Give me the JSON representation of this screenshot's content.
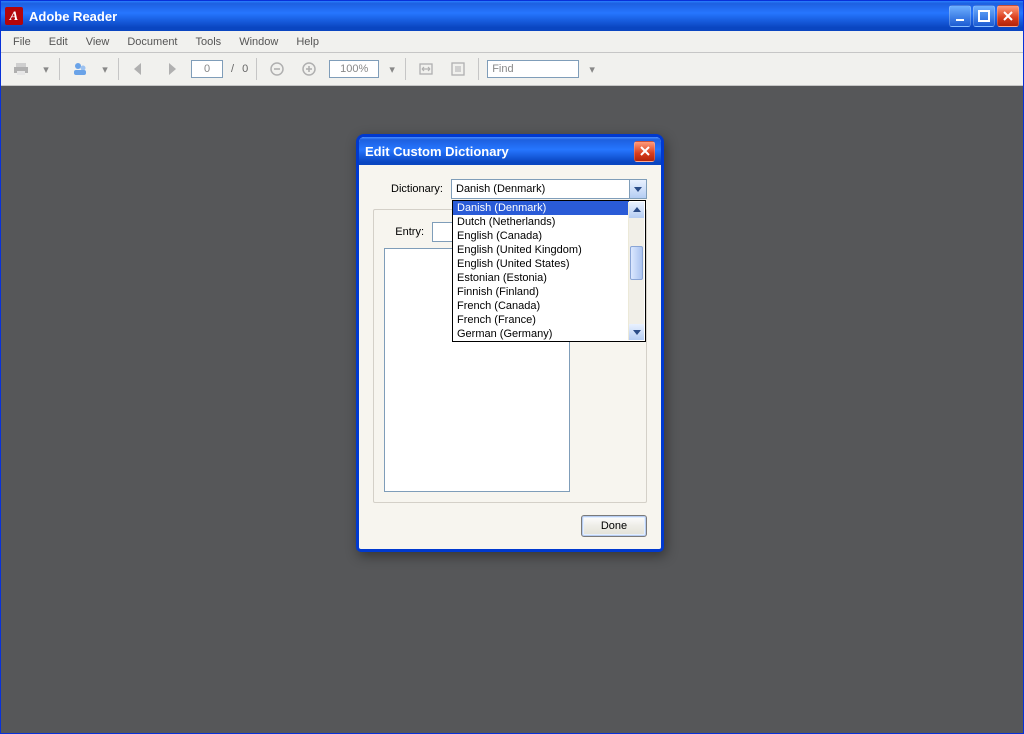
{
  "app": {
    "title": "Adobe Reader",
    "icon_glyph": "A"
  },
  "menu": {
    "items": [
      "File",
      "Edit",
      "View",
      "Document",
      "Tools",
      "Window",
      "Help"
    ]
  },
  "toolbar": {
    "page_current": "0",
    "page_total": "0",
    "page_sep": "/",
    "zoom": "100%",
    "find_placeholder": "Find"
  },
  "dialog": {
    "title": "Edit Custom Dictionary",
    "dictionary_label": "Dictionary:",
    "dictionary_selected": "Danish (Denmark)",
    "entry_label": "Entry:",
    "done_label": "Done",
    "options": [
      "Danish (Denmark)",
      "Dutch (Netherlands)",
      "English (Canada)",
      "English (United Kingdom)",
      "English (United States)",
      "Estonian (Estonia)",
      "Finnish (Finland)",
      "French (Canada)",
      "French (France)",
      "German (Germany)"
    ],
    "selected_index": 0
  }
}
